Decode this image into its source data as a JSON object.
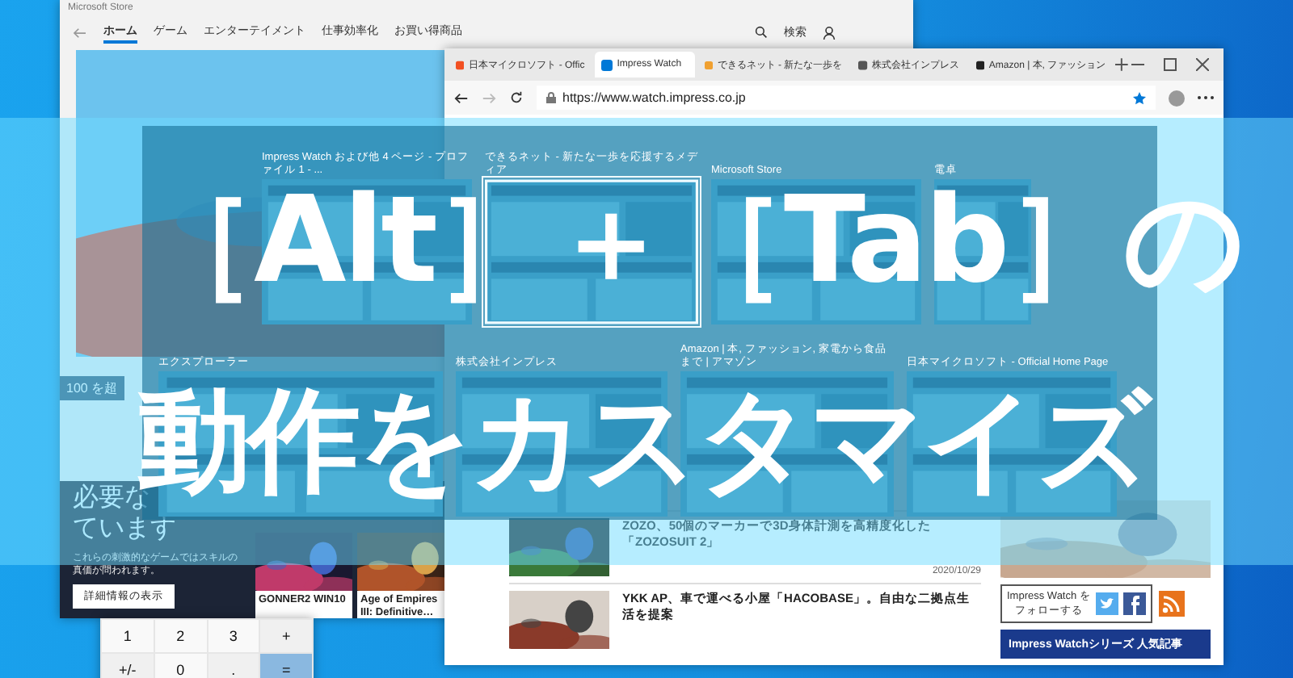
{
  "store_window": {
    "title": "Microsoft Store",
    "nav": [
      {
        "label": "ホーム",
        "selected": true
      },
      {
        "label": "ゲーム",
        "selected": false
      },
      {
        "label": "エンターテイメント",
        "selected": false
      },
      {
        "label": "仕事効率化",
        "selected": false
      },
      {
        "label": "お買い得商品",
        "selected": false
      }
    ],
    "search_label": "検索",
    "side_text": "100 を超",
    "promo": {
      "heading_lines": [
        "必要な",
        "ています"
      ],
      "text": "これらの刺激的なゲームではスキルの真価が問われます。",
      "button": "詳細情報の表示"
    },
    "games": [
      {
        "title": "GONNER2 WIN10"
      },
      {
        "title": "Age of Empires III: Definitive…"
      }
    ]
  },
  "calculator": {
    "keys": [
      {
        "label": "1",
        "kind": "digit"
      },
      {
        "label": "2",
        "kind": "digit"
      },
      {
        "label": "3",
        "kind": "digit"
      },
      {
        "label": "+",
        "kind": "operator"
      },
      {
        "label": "+/-",
        "kind": "operator"
      },
      {
        "label": "0",
        "kind": "digit"
      },
      {
        "label": ".",
        "kind": "operator"
      },
      {
        "label": "=",
        "kind": "equals"
      }
    ]
  },
  "browser": {
    "tabs": [
      {
        "label": "日本マイクロソフト - Offic",
        "selected": false
      },
      {
        "label": "Impress Watch",
        "selected": true
      },
      {
        "label": "できるネット - 新たな一歩を",
        "selected": false
      },
      {
        "label": "株式会社インプレス",
        "selected": false
      },
      {
        "label": "Amazon | 本, ファッション",
        "selected": false
      }
    ],
    "url": "https://www.watch.impress.co.jp",
    "articles": [
      {
        "title": "ZOZO、50個のマーカーで3D身体計測を高精度化した「ZOZOSUIT 2」",
        "date": "2020/10/29"
      },
      {
        "title": "YKK AP、車で運べる小屋「HACOBASE」。自由な二拠点生活を提案"
      }
    ],
    "follow_lines": [
      "Impress Watch を",
      "フォローする"
    ],
    "ranking_title": "Impress Watchシリーズ 人気記事"
  },
  "switcher": {
    "windows": [
      {
        "title": "Impress Watch および他 4 ページ - プロファイル 1 - ...",
        "selected": false
      },
      {
        "title": "できるネット - 新たな一歩を応援するメディア",
        "selected": true
      },
      {
        "title": "Microsoft Store",
        "selected": false
      },
      {
        "title": "電卓",
        "selected": false
      },
      {
        "title": "エクスプローラー",
        "selected": false
      },
      {
        "title": "株式会社インプレス",
        "selected": false
      },
      {
        "title": "Amazon | 本, ファッション, 家電から食品まで | アマゾン",
        "selected": false
      },
      {
        "title": "日本マイクロソフト - Official Home Page",
        "selected": false
      }
    ]
  },
  "headline": {
    "lines": [
      "［Alt］＋［Tab］の",
      "動作をカスタマイズ"
    ]
  }
}
